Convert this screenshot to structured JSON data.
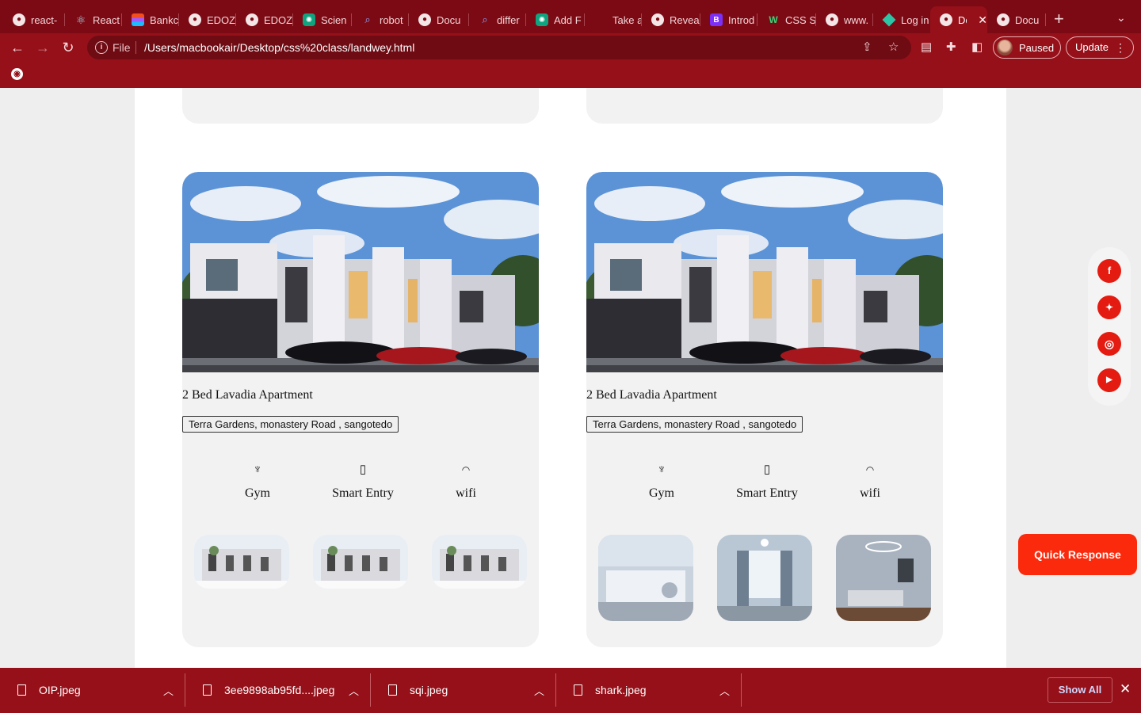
{
  "browser": {
    "tabs": [
      {
        "title": "react-",
        "icon": "globe-icon"
      },
      {
        "title": "React",
        "icon": "react-icon"
      },
      {
        "title": "Bankc",
        "icon": "figma-icon"
      },
      {
        "title": "EDOZ",
        "icon": "globe-icon"
      },
      {
        "title": "EDOZ",
        "icon": "globe-icon"
      },
      {
        "title": "Scien",
        "icon": "chatgpt-icon"
      },
      {
        "title": "robot",
        "icon": "search-icon"
      },
      {
        "title": "Docu",
        "icon": "globe-icon"
      },
      {
        "title": "differ",
        "icon": "search-icon"
      },
      {
        "title": "Add F",
        "icon": "chatgpt-icon"
      },
      {
        "title": "Take a",
        "icon": "apple-icon"
      },
      {
        "title": "Revea",
        "icon": "globe-icon"
      },
      {
        "title": "Introd",
        "icon": "bootstrap-icon"
      },
      {
        "title": "CSS S",
        "icon": "w3schools-icon"
      },
      {
        "title": "www.",
        "icon": "globe-icon"
      },
      {
        "title": "Log in",
        "icon": "diamond-icon"
      },
      {
        "title": "Do",
        "icon": "globe-icon",
        "active": true
      },
      {
        "title": "Docu",
        "icon": "globe-icon"
      }
    ],
    "new_tab_label": "+",
    "address": {
      "scheme": "File",
      "url": "/Users/macbookair/Desktop/css%20class/landwey.html"
    },
    "profile_label": "Paused",
    "update_label": "Update"
  },
  "listings": [
    {
      "title": "2 Bed Lavadia Apartment",
      "address": "Terra Gardens, monastery Road , sangotedo",
      "amenities": [
        {
          "label": "Gym",
          "icon": "dumbbell-icon"
        },
        {
          "label": "Smart Entry",
          "icon": "phone-icon"
        },
        {
          "label": "wifi",
          "icon": "wifi-icon"
        }
      ],
      "gallery": [
        "exterior-thumbnail",
        "exterior-thumbnail",
        "exterior-thumbnail"
      ]
    },
    {
      "title": "2 Bed Lavadia Apartment",
      "address": "Terra Gardens, monastery Road , sangotedo",
      "amenities": [
        {
          "label": "Gym",
          "icon": "dumbbell-icon"
        },
        {
          "label": "Smart Entry",
          "icon": "phone-icon"
        },
        {
          "label": "wifi",
          "icon": "wifi-icon"
        }
      ],
      "gallery": [
        "kitchen-thumbnail",
        "bedroom-thumbnail",
        "living-room-thumbnail"
      ]
    }
  ],
  "social": [
    "facebook-icon",
    "twitter-icon",
    "instagram-icon",
    "youtube-icon"
  ],
  "quick_response_label": "Quick Response",
  "downloads": {
    "items": [
      {
        "name": "OIP.jpeg"
      },
      {
        "name": "3ee9898ab95fd....jpeg"
      },
      {
        "name": "sqi.jpeg"
      },
      {
        "name": "shark.jpeg"
      }
    ],
    "show_all_label": "Show All"
  },
  "colors": {
    "chrome": "#951019",
    "tabstrip": "#7c0a14",
    "accent_red": "#e41b10",
    "quick_response": "#fb2a0c"
  }
}
